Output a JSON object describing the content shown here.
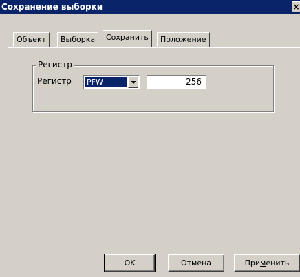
{
  "window": {
    "title": "Сохранение выборки",
    "close_label": "×"
  },
  "tabs": [
    {
      "label": "Объект",
      "active": false
    },
    {
      "label": "Выборка",
      "active": false
    },
    {
      "label": "Сохранить",
      "active": true
    },
    {
      "label": "Положение",
      "active": false
    }
  ],
  "register_group": {
    "title": "Регистр",
    "field_label": "Регистр",
    "register_type": "PFW",
    "register_number": "256"
  },
  "buttons": {
    "ok": "OK",
    "cancel": "Отмена",
    "apply_pre": "При",
    "apply_accel": "м",
    "apply_post": "енить"
  }
}
